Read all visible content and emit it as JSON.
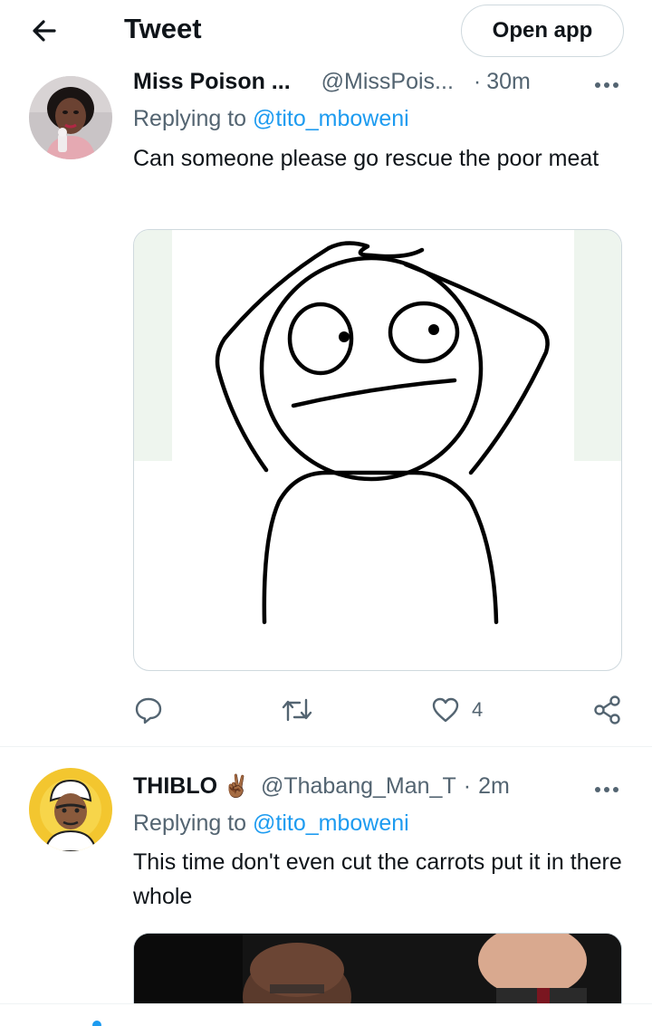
{
  "header": {
    "title": "Tweet",
    "open_app_label": "Open app",
    "back_icon": "arrow-left-icon"
  },
  "tweets": [
    {
      "display_name": "Miss Poison ...",
      "handle": "@MissPois...",
      "separator": "·",
      "time": "30m",
      "replying_prefix": "Replying to ",
      "replying_to": "@tito_mboweni",
      "text": "Can someone please go rescue the poor meat",
      "media": "stick-figure-meme",
      "actions": {
        "reply_count": "",
        "retweet_count": "",
        "like_count": "4"
      }
    },
    {
      "display_name": "THIBLO",
      "name_emoji": "✌🏾",
      "handle": "@Thabang_Man_T",
      "separator": "·",
      "time": "2m",
      "replying_prefix": "Replying to ",
      "replying_to": "@tito_mboweni",
      "text": "This time don't even cut the carrots put it in there whole",
      "media": "photo"
    }
  ],
  "colors": {
    "accent": "#1d9bf0",
    "secondary_text": "#536471",
    "border": "#cfd9de"
  }
}
